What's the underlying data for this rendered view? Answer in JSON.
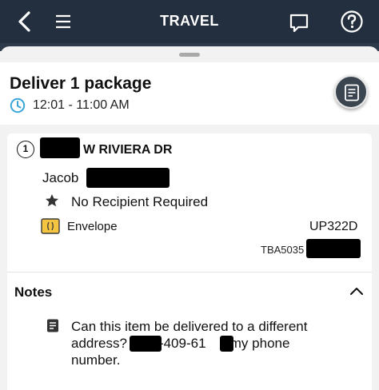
{
  "topbar": {
    "title": "TRAVEL",
    "back_icon": "chevron-left-icon",
    "menu_icon": "hamburger-menu-icon",
    "chat_icon": "chat-bubble-icon",
    "help_icon": "question-circle-icon"
  },
  "task": {
    "title": "Deliver 1 package",
    "time_window": "12:01 - 11:00 AM",
    "time_icon": "clock-icon",
    "accent_color": "#3aa6d8"
  },
  "stop": {
    "number": "1",
    "address_suffix": "W RIVIERA DR",
    "recipient_first_name": "Jacob",
    "requirement": "No Recipient Required",
    "package_type": "Envelope",
    "package_code": "UP322D",
    "tracking_prefix": "TBA5035"
  },
  "notes": {
    "title": "Notes",
    "line1": "Can this item be delivered to a different",
    "line2_a": "address?",
    "line2_b": "-409-61",
    "line2_c": "s my phone",
    "line3": "number."
  }
}
